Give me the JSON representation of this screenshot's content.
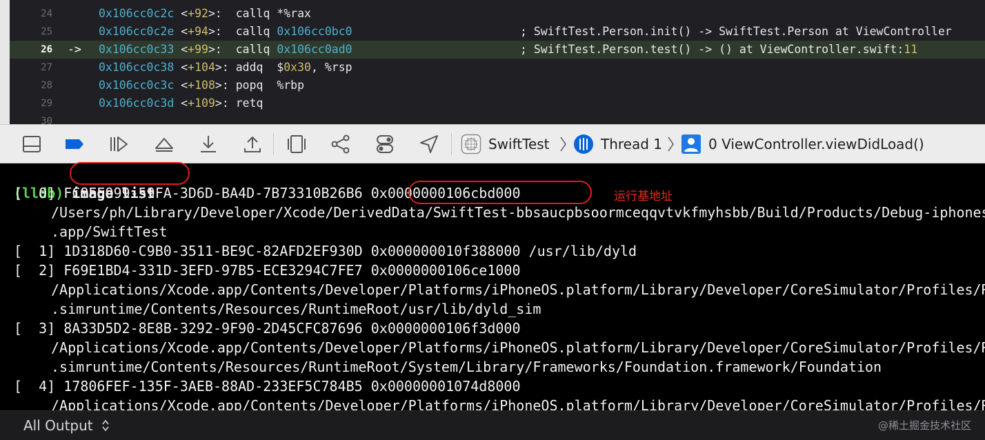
{
  "disassembly": {
    "lines": [
      {
        "ln": "24",
        "arrow": "",
        "addr": "0x106cc0c2c",
        "offset": "+92",
        "instr": "callq",
        "operand": "*%rax",
        "comment": ""
      },
      {
        "ln": "25",
        "arrow": "",
        "addr": "0x106cc0c2e",
        "offset": "+94",
        "instr": "callq",
        "operand": "0x106cc0bc0",
        "comment": "; SwiftTest.Person.init() -> SwiftTest.Person at ViewController"
      },
      {
        "ln": "26",
        "arrow": "->",
        "addr": "0x106cc0c33",
        "offset": "+99",
        "instr": "callq",
        "operand": "0x106cc0ad0",
        "comment": "; SwiftTest.Person.test() -> () at ViewController.swift:",
        "comment_num": "11"
      },
      {
        "ln": "27",
        "arrow": "",
        "addr": "0x106cc0c38",
        "offset": "+104",
        "instr": "addq",
        "operand_pre": "$",
        "operand_num": "0x30",
        "operand_post": ", %rsp",
        "comment": ""
      },
      {
        "ln": "28",
        "arrow": "",
        "addr": "0x106cc0c3c",
        "offset": "+108",
        "instr": "popq",
        "operand": "%rbp",
        "comment": ""
      },
      {
        "ln": "29",
        "arrow": "",
        "addr": "0x106cc0c3d",
        "offset": "+109",
        "instr": "retq",
        "operand": "",
        "comment": ""
      },
      {
        "ln": "30",
        "arrow": "",
        "addr": "",
        "offset": "",
        "instr": "",
        "operand": "",
        "comment": ""
      }
    ],
    "current_line_index": 2
  },
  "debugbar": {
    "buttons": [
      {
        "name": "toggle-console-button",
        "icon": "console-panel-icon"
      },
      {
        "name": "breakpoints-toggle-button",
        "icon": "breakpoint-icon"
      },
      {
        "name": "continue-button",
        "icon": "continue-icon"
      },
      {
        "name": "step-over-button",
        "icon": "step-over-icon"
      },
      {
        "name": "step-into-button",
        "icon": "step-into-icon"
      },
      {
        "name": "step-out-button",
        "icon": "step-out-icon"
      },
      {
        "name": "debug-view-hierarchy-button",
        "icon": "view-hierarchy-icon"
      },
      {
        "name": "memory-graph-button",
        "icon": "memory-graph-icon"
      },
      {
        "name": "environment-overrides-button",
        "icon": "environment-overrides-icon"
      },
      {
        "name": "simulate-location-button",
        "icon": "location-arrow-icon"
      }
    ],
    "breadcrumbs": {
      "target": "SwiftTest",
      "thread": "Thread 1",
      "frame": "0 ViewController.viewDidLoad()"
    },
    "accent_color": "#0a64d8"
  },
  "console": {
    "prompt": "(lldb)",
    "command": "image list",
    "lines": [
      {
        "indent": false,
        "text": "[  0] FC8EE999-59FA-3D6D-BA4D-7B73310B26B6 0x0000000106cbd000"
      },
      {
        "indent": true,
        "text": "/Users/ph/Library/Developer/Xcode/DerivedData/SwiftTest-bbsaucpbsoormceqqvtvkfmyhsbb/Build/Products/Debug-iphonesimulator/SwiftTest"
      },
      {
        "indent": true,
        "text": ".app/SwiftTest"
      },
      {
        "indent": false,
        "text": "[  1] 1D318D60-C9B0-3511-BE9C-82AFD2EF930D 0x000000010f388000 /usr/lib/dyld"
      },
      {
        "indent": false,
        "text": "[  2] F69E1BD4-331D-3EFD-97B5-ECE3294C7FE7 0x0000000106ce1000"
      },
      {
        "indent": true,
        "text": "/Applications/Xcode.app/Contents/Developer/Platforms/iPhoneOS.platform/Library/Developer/CoreSimulator/Profiles/Runtimes/iOS"
      },
      {
        "indent": true,
        "text": ".simruntime/Contents/Resources/RuntimeRoot/usr/lib/dyld_sim"
      },
      {
        "indent": false,
        "text": "[  3] 8A33D5D2-8E8B-3292-9F90-2D45CFC87696 0x0000000106f3d000"
      },
      {
        "indent": true,
        "text": "/Applications/Xcode.app/Contents/Developer/Platforms/iPhoneOS.platform/Library/Developer/CoreSimulator/Profiles/Runtimes/iOS"
      },
      {
        "indent": true,
        "text": ".simruntime/Contents/Resources/RuntimeRoot/System/Library/Frameworks/Foundation.framework/Foundation"
      },
      {
        "indent": false,
        "text": "[  4] 17806FEF-135F-3AEB-88AD-233EF5C784B5 0x00000001074d8000"
      },
      {
        "indent": true,
        "text": "/Applications/Xcode.app/Contents/Developer/Platforms/iPhoneOS.platform/Library/Developer/CoreSimulator/Profiles/Runtimes/iOS"
      }
    ],
    "annotation": "运行基地址",
    "prompt_color": "#59d64c",
    "highlight_color": "#e0201b"
  },
  "bottombar": {
    "filter_label": "All Output",
    "watermark": "@稀土掘金技术社区"
  }
}
